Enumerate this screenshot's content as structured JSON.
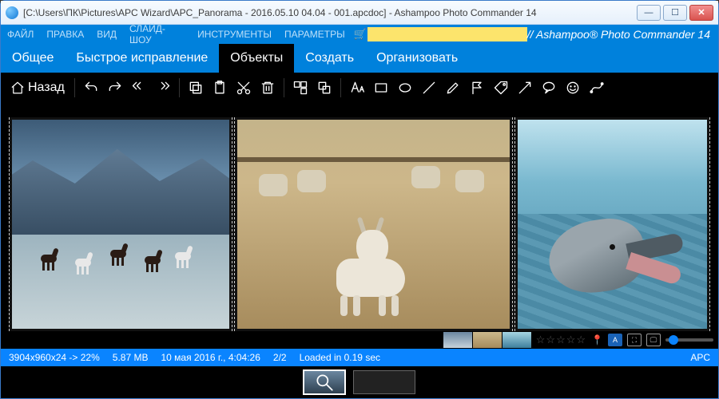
{
  "window": {
    "title": "[C:\\Users\\ПК\\Pictures\\APC Wizard\\APC_Panorama - 2016.05.10 04.04 - 001.apcdoc] - Ashampoo Photo Commander 14"
  },
  "menu": {
    "items": [
      "ФАЙЛ",
      "ПРАВКА",
      "ВИД",
      "СЛАЙД-ШОУ",
      "ИНСТРУМЕНТЫ",
      "ПАРАМЕТРЫ"
    ],
    "brand": "// Ashampoo® Photo Commander 14"
  },
  "tabs": {
    "items": [
      "Общее",
      "Быстрое исправление",
      "Объекты",
      "Создать",
      "Организовать"
    ],
    "active_index": 2
  },
  "toolbar": {
    "back_label": "Назад",
    "buttons": [
      "undo",
      "redo",
      "undo2",
      "redo2",
      "copy",
      "paste",
      "cut",
      "delete",
      "group",
      "ungroup",
      "text",
      "rect",
      "ellipse",
      "line",
      "pencil",
      "flag",
      "tag",
      "arrow",
      "bubble",
      "smiley",
      "spline"
    ]
  },
  "panorama": {
    "panes": [
      {
        "name": "horses",
        "width_fr": 32
      },
      {
        "name": "goat",
        "width_fr": 40
      },
      {
        "name": "dolphin",
        "width_fr": 28
      }
    ]
  },
  "rating": {
    "stars": 5,
    "filled": 0
  },
  "status": {
    "dims": "3904x960x24 -> 22%",
    "size": "5.87 MB",
    "date": "10 мая 2016 г., 4:04:26",
    "index": "2/2",
    "load": "Loaded in 0.19 sec",
    "format": "APC"
  }
}
